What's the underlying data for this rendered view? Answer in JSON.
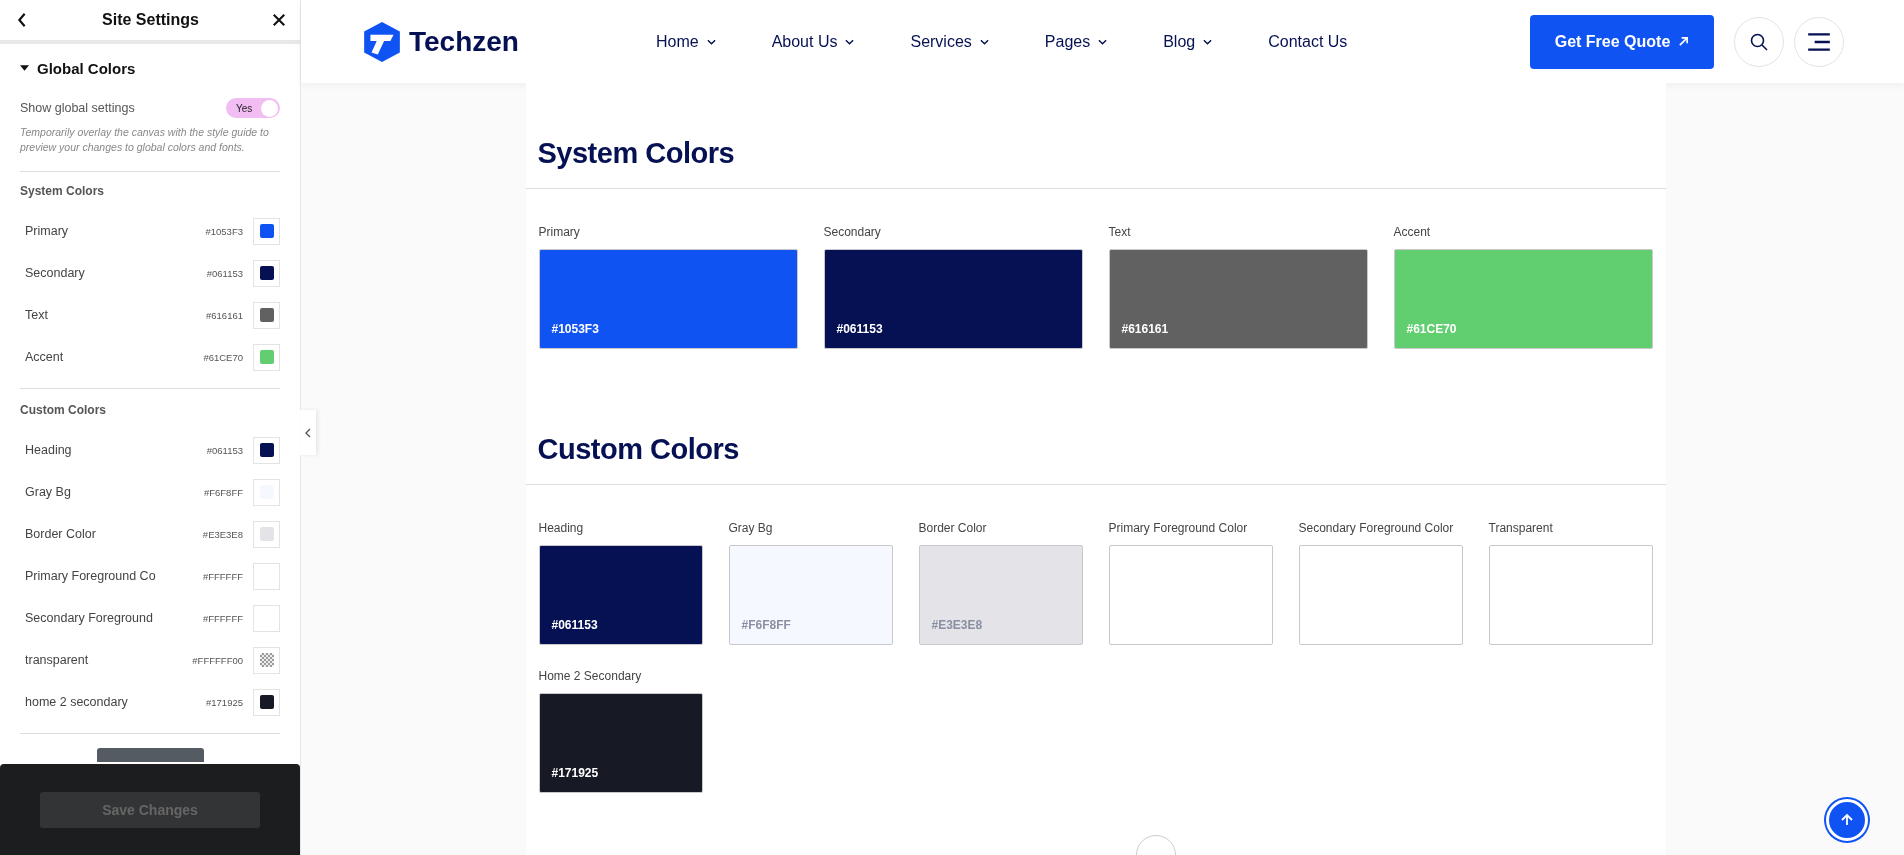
{
  "sidebar": {
    "title": "Site Settings",
    "section": {
      "title": "Global Colors",
      "expanded": true
    },
    "toggle": {
      "label": "Show global settings",
      "on": true,
      "text": "Yes"
    },
    "hint": "Temporarily overlay the canvas with the style guide to preview your changes to global colors and fonts.",
    "groups": [
      {
        "title": "System Colors",
        "items": [
          {
            "name": "Primary",
            "hex": "#1053F3",
            "color": "#1053f3",
            "kind": "solid"
          },
          {
            "name": "Secondary",
            "hex": "#061153",
            "color": "#061153",
            "kind": "solid"
          },
          {
            "name": "Text",
            "hex": "#616161",
            "color": "#616161",
            "kind": "solid"
          },
          {
            "name": "Accent",
            "hex": "#61CE70",
            "color": "#61ce70",
            "kind": "solid"
          }
        ]
      },
      {
        "title": "Custom Colors",
        "items": [
          {
            "name": "Heading",
            "hex": "#061153",
            "color": "#061153",
            "kind": "solid"
          },
          {
            "name": "Gray Bg",
            "hex": "#F6F8FF",
            "color": "#f6f8ff",
            "kind": "solid"
          },
          {
            "name": "Border Color",
            "hex": "#E3E3E8",
            "color": "#e3e3e8",
            "kind": "solid"
          },
          {
            "name": "Primary Foreground Co",
            "hex": "#FFFFFF",
            "color": "#ffffff",
            "kind": "solid"
          },
          {
            "name": "Secondary Foreground",
            "hex": "#FFFFFF",
            "color": "#ffffff",
            "kind": "solid"
          },
          {
            "name": "transparent",
            "hex": "#FFFFFF00",
            "kind": "checker"
          },
          {
            "name": "home 2 secondary",
            "hex": "#171925",
            "color": "#171925",
            "kind": "solid"
          }
        ]
      }
    ],
    "save_button": {
      "label": "Save Changes",
      "disabled": true
    }
  },
  "header": {
    "logo": "Techzen",
    "nav": [
      {
        "label": "Home",
        "dropdown": true
      },
      {
        "label": "About Us",
        "dropdown": true
      },
      {
        "label": "Services",
        "dropdown": true
      },
      {
        "label": "Pages",
        "dropdown": true
      },
      {
        "label": "Blog",
        "dropdown": true
      },
      {
        "label": "Contact Us",
        "dropdown": false
      }
    ],
    "cta": "Get Free Quote"
  },
  "sections": [
    {
      "title": "System Colors",
      "wide": true,
      "cards": [
        {
          "label": "Primary",
          "hex": "#1053F3",
          "color": "#1053f3"
        },
        {
          "label": "Secondary",
          "hex": "#061153",
          "color": "#061153"
        },
        {
          "label": "Text",
          "hex": "#616161",
          "color": "#616161"
        },
        {
          "label": "Accent",
          "hex": "#61CE70",
          "color": "#61ce70"
        }
      ]
    },
    {
      "title": "Custom Colors",
      "wide": false,
      "cards": [
        {
          "label": "Heading",
          "hex": "#061153",
          "color": "#061153"
        },
        {
          "label": "Gray Bg",
          "hex": "#F6F8FF",
          "color": "#f6f8ff"
        },
        {
          "label": "Border Color",
          "hex": "#E3E3E8",
          "color": "#e3e3e8"
        },
        {
          "label": "Primary Foreground Color",
          "color": "#ffffff"
        },
        {
          "label": "Secondary Foreground Color",
          "color": "#ffffff"
        },
        {
          "label": "Transparent",
          "color": "#ffffff"
        },
        {
          "label": "Home 2 Secondary",
          "hex": "#171925",
          "color": "#171925"
        }
      ]
    }
  ]
}
